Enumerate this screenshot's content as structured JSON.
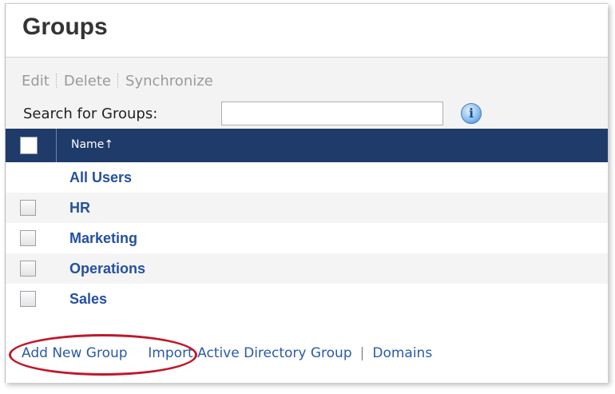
{
  "page": {
    "title": "Groups"
  },
  "toolbar": {
    "actions": [
      "Edit",
      "Delete",
      "Synchronize"
    ],
    "search_label": "Search for Groups:",
    "search_value": "",
    "info_glyph": "i"
  },
  "table": {
    "column_name": "Name",
    "sort_indicator": "↑",
    "rows": [
      {
        "name": "All Users",
        "has_checkbox": false,
        "checked": false
      },
      {
        "name": "HR",
        "has_checkbox": true,
        "checked": false
      },
      {
        "name": "Marketing",
        "has_checkbox": true,
        "checked": false
      },
      {
        "name": "Operations",
        "has_checkbox": true,
        "checked": false
      },
      {
        "name": "Sales",
        "has_checkbox": true,
        "checked": false
      }
    ]
  },
  "footer": {
    "links": [
      "Add New Group",
      "Import Active Directory Group",
      "Domains"
    ],
    "separator": "|"
  },
  "icons": [
    "info-icon",
    "sort-ascending-icon"
  ],
  "colors": {
    "header": "#1f3b6a",
    "link": "#2a5aa8",
    "highlight": "#c0182a"
  }
}
